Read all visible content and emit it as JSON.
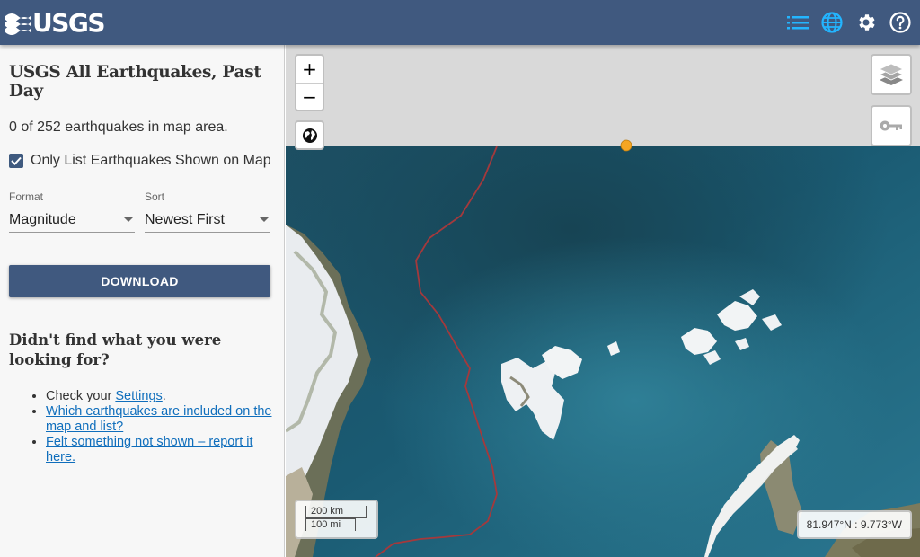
{
  "header": {
    "logo_text": "USGS",
    "icons": [
      "list-icon",
      "globe-icon",
      "gear-icon",
      "help-icon"
    ],
    "colors": {
      "bar": "#40597f",
      "active_icon": "#23b5ff"
    }
  },
  "sidebar": {
    "title": "USGS All Earthquakes, Past Day",
    "count_text": "0 of 252 earthquakes in map area.",
    "checkbox_label": "Only List Earthquakes Shown on Map",
    "checkbox_checked": true,
    "format": {
      "label": "Format",
      "value": "Magnitude"
    },
    "sort": {
      "label": "Sort",
      "value": "Newest First"
    },
    "download_label": "DOWNLOAD",
    "help_title": "Didn't find what you were looking for?",
    "help_items": [
      {
        "prefix": "Check your ",
        "link": "Settings",
        "suffix": "."
      },
      {
        "prefix": "",
        "link": "Which earthquakes are included on the map and list?",
        "suffix": ""
      },
      {
        "prefix": "",
        "link": "Felt something not shown – report it here.",
        "suffix": ""
      }
    ]
  },
  "map": {
    "zoom_in": "+",
    "zoom_out": "−",
    "scale_km": "200 km",
    "scale_mi": "100 mi",
    "coordinates": "81.947°N : 9.773°W",
    "earthquake_marker_color": "#f5a623"
  }
}
